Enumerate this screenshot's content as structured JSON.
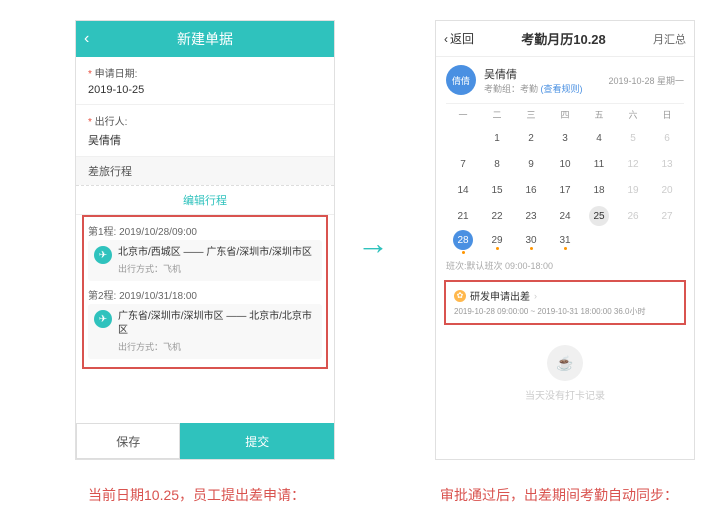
{
  "left": {
    "header_title": "新建单据",
    "apply_date_label": "申请日期:",
    "apply_date_value": "2019-10-25",
    "traveler_label": "出行人:",
    "traveler_value": "吴倩倩",
    "trip_section": "差旅行程",
    "edit_trip": "编辑行程",
    "seg1_label": "第1程:  2019/10/28/09:00",
    "seg1_route": "北京市/西城区 —— 广东省/深圳市/深圳市区",
    "seg1_mode": "出行方式：飞机",
    "seg2_label": "第2程:  2019/10/31/18:00",
    "seg2_route": "广东省/深圳市/深圳市区 —— 北京市/北京市区",
    "seg2_mode": "出行方式：飞机",
    "save": "保存",
    "submit": "提交"
  },
  "right": {
    "back": "返回",
    "title": "考勤月历10.28",
    "summary": "月汇总",
    "avatar": "倩倩",
    "user_name": "吴倩倩",
    "user_group_prefix": "考勤组：考勤  ",
    "user_rules": "(查看规则)",
    "date_text": "2019-10-28 星期一",
    "dow": [
      "一",
      "二",
      "三",
      "四",
      "五",
      "六",
      "日"
    ],
    "weeks": [
      [
        {
          "n": "",
          "g": true
        },
        {
          "n": "1"
        },
        {
          "n": "2"
        },
        {
          "n": "3"
        },
        {
          "n": "4"
        },
        {
          "n": "5",
          "g": true
        },
        {
          "n": "6",
          "g": true
        }
      ],
      [
        {
          "n": "7"
        },
        {
          "n": "8"
        },
        {
          "n": "9"
        },
        {
          "n": "10"
        },
        {
          "n": "11"
        },
        {
          "n": "12",
          "g": true
        },
        {
          "n": "13",
          "g": true
        }
      ],
      [
        {
          "n": "14"
        },
        {
          "n": "15"
        },
        {
          "n": "16"
        },
        {
          "n": "17"
        },
        {
          "n": "18"
        },
        {
          "n": "19",
          "g": true
        },
        {
          "n": "20",
          "g": true
        }
      ],
      [
        {
          "n": "21"
        },
        {
          "n": "22"
        },
        {
          "n": "23"
        },
        {
          "n": "24"
        },
        {
          "n": "25",
          "selgrey": true
        },
        {
          "n": "26",
          "g": true
        },
        {
          "n": "27",
          "g": true
        }
      ],
      [
        {
          "n": "28",
          "selblue": true,
          "dot": true
        },
        {
          "n": "29",
          "dot": true
        },
        {
          "n": "30",
          "dot": true
        },
        {
          "n": "31",
          "dot": true
        },
        {
          "n": "",
          "g": true
        },
        {
          "n": "",
          "g": true
        },
        {
          "n": "",
          "g": true
        }
      ]
    ],
    "shift_label": "班次:默认班次 09:00-18:00",
    "approval_title": "研发申请出差",
    "approval_detail": "2019-10-28 09:00:00 ~ 2019-10-31 18:00:00 36.0小时",
    "empty_text": "当天没有打卡记录"
  },
  "arrow_glyph": "→",
  "caption_left": "当前日期10.25，员工提出差申请：",
  "caption_right": "审批通过后，出差期间考勤自动同步："
}
